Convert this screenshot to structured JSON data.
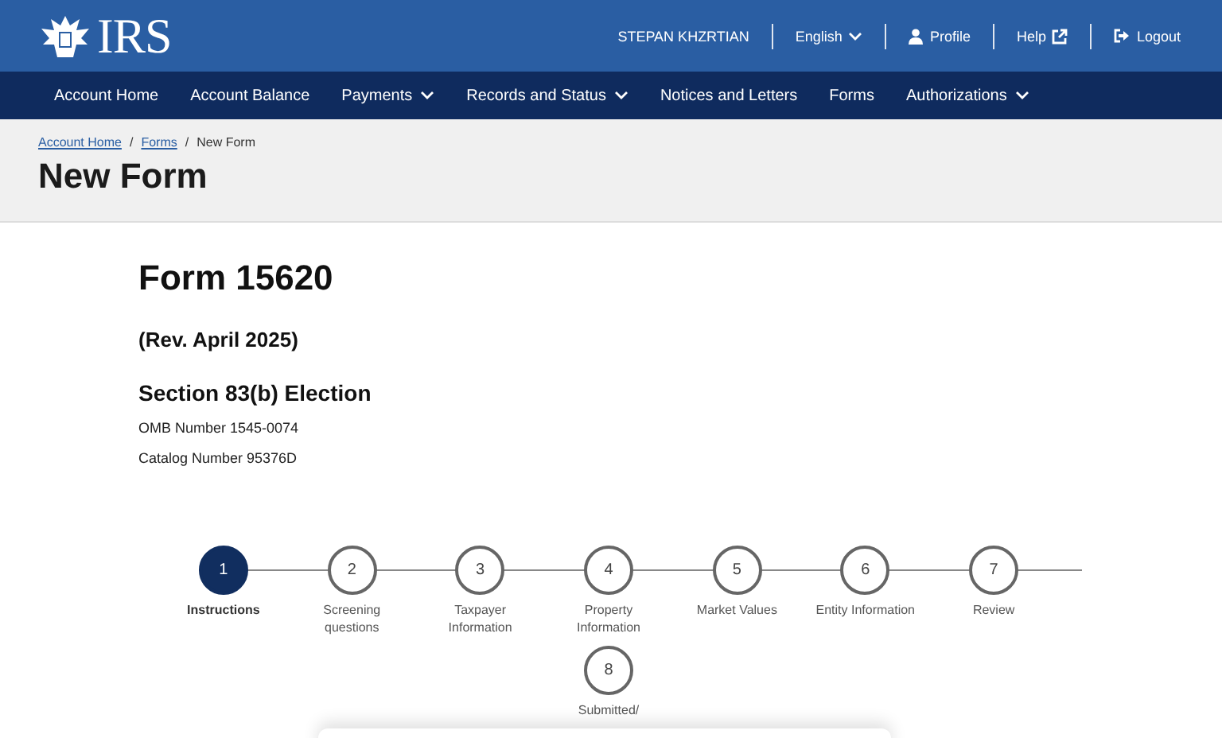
{
  "logo": {
    "text": "IRS"
  },
  "utility_bar": {
    "user": "STEPAN KHZRTIAN",
    "language": "English",
    "links": [
      {
        "label": "Profile",
        "kind": "profile"
      },
      {
        "label": "Help",
        "kind": "help"
      },
      {
        "label": "Logout",
        "kind": "logout"
      }
    ]
  },
  "nav": [
    {
      "label": "Account Home",
      "dropdown": false
    },
    {
      "label": "Account Balance",
      "dropdown": false
    },
    {
      "label": "Payments",
      "dropdown": true
    },
    {
      "label": "Records and Status",
      "dropdown": true
    },
    {
      "label": "Notices and Letters",
      "dropdown": false
    },
    {
      "label": "Forms",
      "dropdown": false
    },
    {
      "label": "Authorizations",
      "dropdown": true
    }
  ],
  "breadcrumbs": [
    {
      "label": "Account Home",
      "kind": "link"
    },
    {
      "label": "/",
      "kind": "separator"
    },
    {
      "label": "Forms",
      "kind": "link"
    },
    {
      "label": "/",
      "kind": "separator"
    },
    {
      "label": "New Form",
      "kind": "current"
    }
  ],
  "page_title": "New Form",
  "form": {
    "title": "Form 15620",
    "revision": "(Rev. April 2025)",
    "subtitle": "Section 83(b) Election",
    "omb": "OMB Number 1545-0074",
    "catalog": "Catalog Number 95376D"
  },
  "steps": [
    {
      "number": "1",
      "label": "Instructions",
      "selected": true
    },
    {
      "number": "2",
      "label": "Screening questions",
      "selected": false
    },
    {
      "number": "3",
      "label": "Taxpayer Information",
      "selected": false
    },
    {
      "number": "4",
      "label": "Property Information",
      "selected": false
    },
    {
      "number": "5",
      "label": "Market Values",
      "selected": false
    },
    {
      "number": "6",
      "label": "Entity Information",
      "selected": false
    },
    {
      "number": "7",
      "label": "Review",
      "selected": false
    },
    {
      "number": "8",
      "label": "Submitted/",
      "selected": false
    }
  ]
}
